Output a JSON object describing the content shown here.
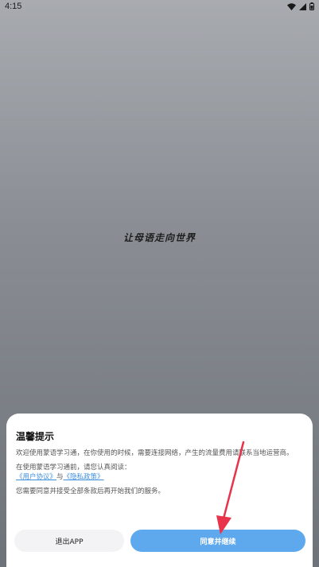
{
  "status_bar": {
    "time": "4:15",
    "icons": [
      "wifi-icon",
      "signal-icon",
      "battery-icon"
    ]
  },
  "splash": {
    "slogan": "让母语走向世界"
  },
  "dialog": {
    "title": "温馨提示",
    "intro": "欢迎使用蒙语学习通，在你使用的时候，需要连接网络，产生的流量费用请联系当地运营商。",
    "read_prompt": "在使用蒙语学习通前，请您认真阅读：",
    "user_agreement": "《用户协议》",
    "and": "与",
    "privacy_policy": "《隐私政策》",
    "consent": "您需要同意并接受全部条款后再开始我们的服务。",
    "exit_label": "退出APP",
    "agree_label": "同意并继续"
  },
  "colors": {
    "accent": "#5ea8ee",
    "link": "#3d8fdc",
    "annotation_arrow": "#e8334a"
  }
}
